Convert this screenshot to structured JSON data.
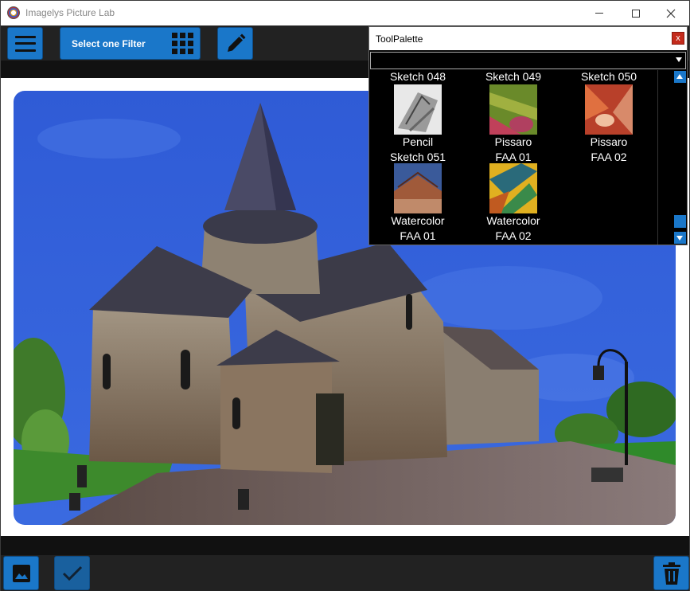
{
  "window": {
    "title": "Imagelys Picture Lab",
    "icons": {
      "app": "app-logo-icon",
      "minimize": "minimize-icon",
      "maximize": "maximize-icon",
      "close": "close-icon"
    }
  },
  "toolbar": {
    "filter_button_label": "Select one Filter",
    "icons": {
      "menu": "hamburger-menu-icon",
      "filters": "grid-icon",
      "edit": "pencil-icon"
    },
    "accent_color": "#1a77c9"
  },
  "tool_palette": {
    "title": "ToolPalette",
    "close_label": "x",
    "dropdown_value": "",
    "items": [
      {
        "caption_top": "Sketch 048",
        "caption_bottom": "Pencil",
        "thumb": "pencil-sketch"
      },
      {
        "caption_top": "Sketch 049",
        "caption_bottom": "Pissaro",
        "thumb": "pissaro-sketch"
      },
      {
        "caption_top": "Sketch 050",
        "caption_bottom": "Pissaro",
        "thumb": "pissaro-red"
      },
      {
        "caption_top": "Sketch 051",
        "caption_bottom": "Watercolor",
        "thumb": "watercolor-house"
      },
      {
        "caption_top": "FAA 01",
        "caption_bottom": "Watercolor",
        "thumb": "watercolor-yellow"
      },
      {
        "caption_top": "FAA 02",
        "caption_bottom": "",
        "thumb": "none"
      }
    ],
    "list_rows": {
      "row1_labels": [
        "Sketch 048",
        "Sketch 049",
        "Sketch 050"
      ],
      "row2_labels_a": [
        "Pencil",
        "Pissaro",
        "Pissaro"
      ],
      "row2_labels_b": [
        "Sketch 051",
        "FAA 01",
        "FAA 02"
      ],
      "row3_labels_a": [
        "Watercolor",
        "Watercolor"
      ],
      "row3_labels_b": [
        "FAA 01",
        "FAA 02"
      ]
    }
  },
  "canvas": {
    "image_description_icon": "church-photo-watercolor-filter"
  },
  "bottombar": {
    "icons": {
      "image": "image-icon",
      "apply": "checkmark-icon",
      "delete": "trash-icon"
    }
  }
}
